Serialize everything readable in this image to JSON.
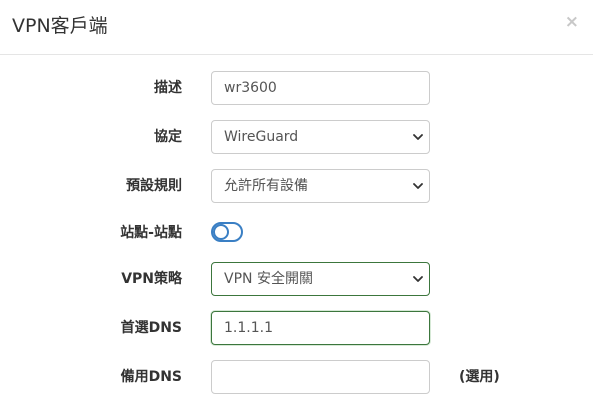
{
  "dialog": {
    "title": "VPN客戶端",
    "close_label": "×"
  },
  "form": {
    "description": {
      "label": "描述",
      "value": "wr3600"
    },
    "protocol": {
      "label": "協定",
      "value": "WireGuard"
    },
    "default_rule": {
      "label": "預設規則",
      "value": "允許所有設備"
    },
    "site_to_site": {
      "label": "站點-站點",
      "enabled": false
    },
    "vpn_policy": {
      "label": "VPN策略",
      "value": "VPN 安全開關"
    },
    "primary_dns": {
      "label": "首選DNS",
      "value": "1.1.1.1"
    },
    "secondary_dns": {
      "label": "備用DNS",
      "value": "",
      "hint": "(選用)"
    }
  },
  "colors": {
    "toggle_accent": "#3a7fc4",
    "success_border": "#3c763d"
  }
}
